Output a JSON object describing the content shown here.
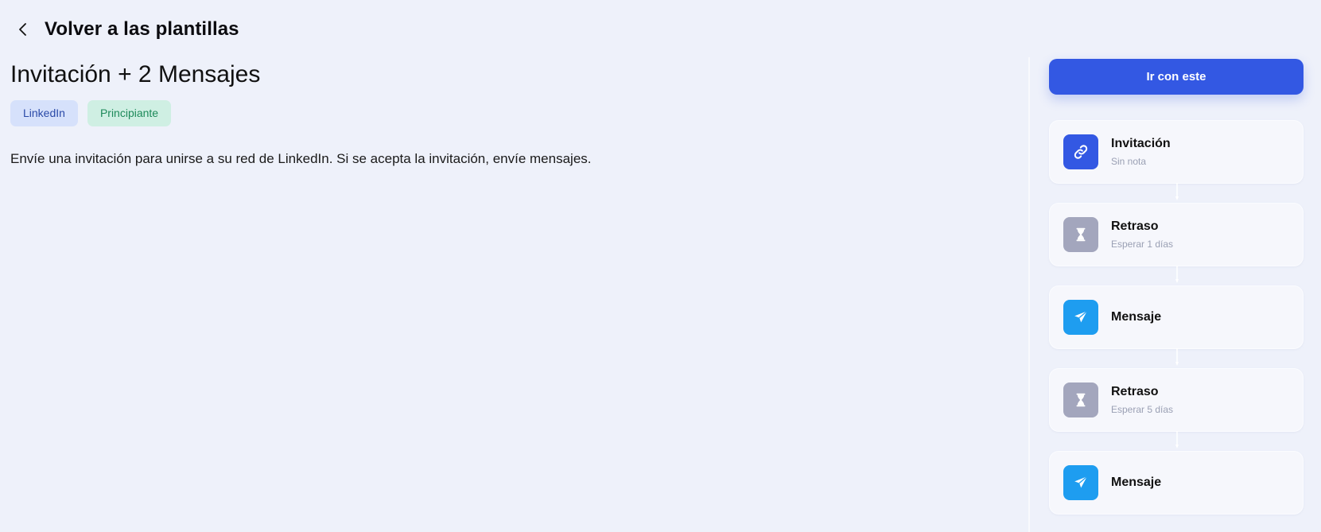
{
  "header": {
    "back_label": "Volver a las plantillas"
  },
  "template": {
    "title": "Invitación + 2 Mensajes",
    "tags": [
      {
        "label": "LinkedIn"
      },
      {
        "label": "Principiante"
      }
    ],
    "description": "Envíe una invitación para unirse a su red de LinkedIn. Si se acepta la invitación, envíe mensajes."
  },
  "sidebar": {
    "cta_label": "Ir con este",
    "steps": [
      {
        "label": "Invitación",
        "sub": "Sin nota",
        "icon": "link-icon",
        "color": "#3358e3"
      },
      {
        "label": "Retraso",
        "sub": "Esperar 1 días",
        "icon": "hourglass-icon",
        "color": "#a3a6bd"
      },
      {
        "label": "Mensaje",
        "sub": "",
        "icon": "send-icon",
        "color": "#1e9df0"
      },
      {
        "label": "Retraso",
        "sub": "Esperar 5 días",
        "icon": "hourglass-icon",
        "color": "#a3a6bd"
      },
      {
        "label": "Mensaje",
        "sub": "",
        "icon": "send-icon",
        "color": "#1e9df0"
      }
    ]
  },
  "colors": {
    "background": "#eef1fa",
    "primary": "#3358e3"
  }
}
